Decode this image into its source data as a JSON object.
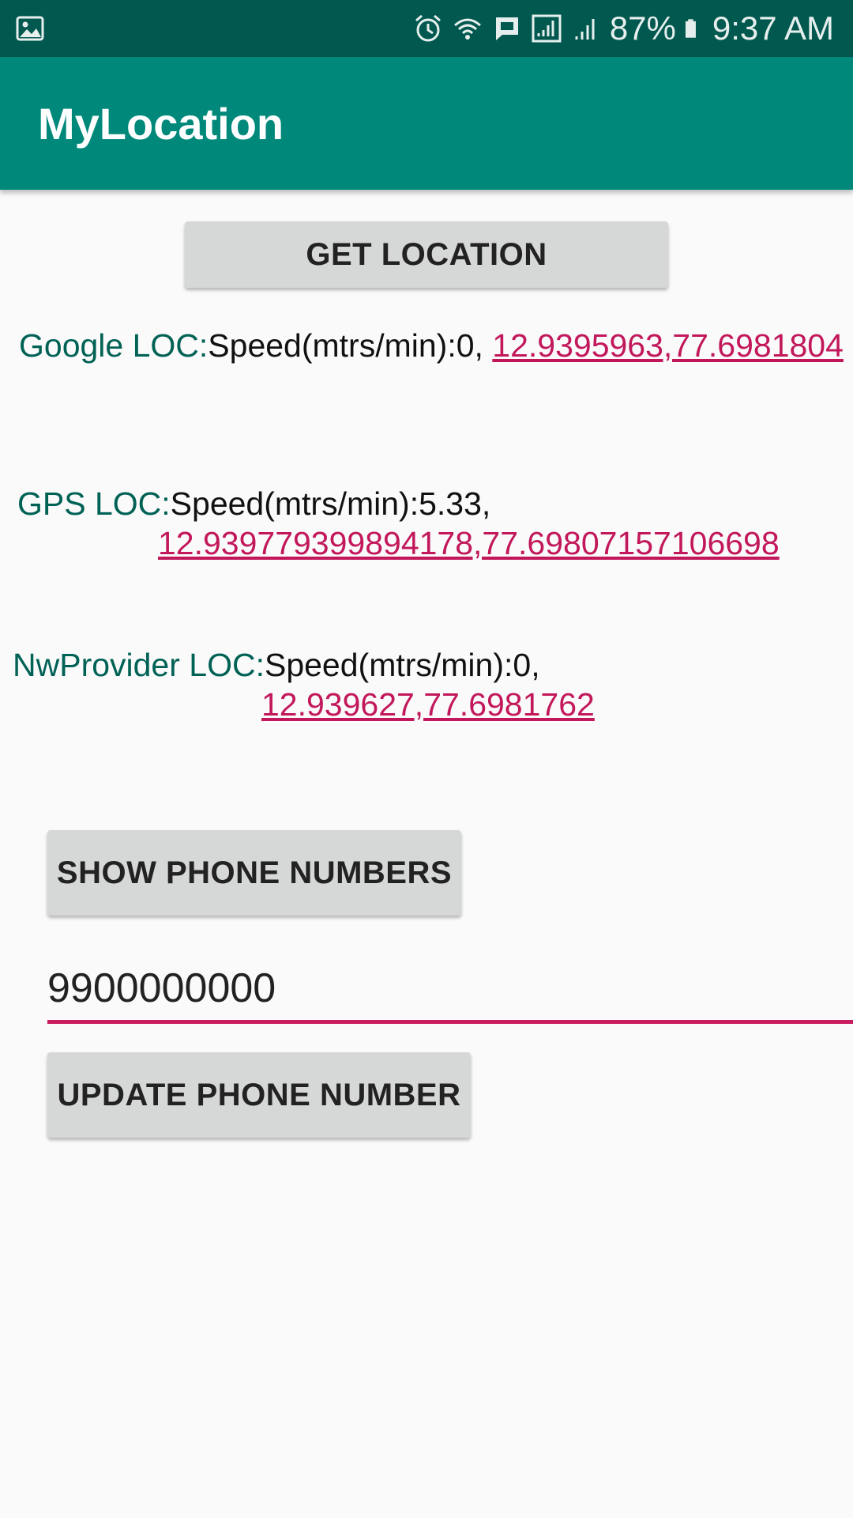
{
  "status_bar": {
    "battery_percent": "87%",
    "time": "9:37 AM",
    "icons": [
      "gallery-icon",
      "alarm-icon",
      "wifi-icon",
      "message-icon",
      "signal-icon",
      "signal-icon",
      "battery-icon"
    ]
  },
  "app_bar": {
    "title": "MyLocation"
  },
  "buttons": {
    "get_location": "GET LOCATION",
    "show_phone_numbers": "SHOW PHONE NUMBERS",
    "update_phone_number": "UPDATE PHONE NUMBER"
  },
  "locations": [
    {
      "label": "Google LOC:",
      "speed": "Speed(mtrs/min):0, ",
      "coords": "12.9395963,77.6981804"
    },
    {
      "label": "GPS LOC:",
      "speed": "Speed(mtrs/min):5.33,",
      "coords": "12.939779399894178,77.69807157106698"
    },
    {
      "label": "NwProvider LOC:",
      "speed": "Speed(mtrs/min):0,",
      "coords": "12.939627,77.6981762"
    }
  ],
  "phone_input": {
    "value": "9900000000"
  },
  "colors": {
    "status_bar": "#00584f",
    "app_bar": "#00897b",
    "accent": "#c2185b",
    "label": "#006155"
  }
}
